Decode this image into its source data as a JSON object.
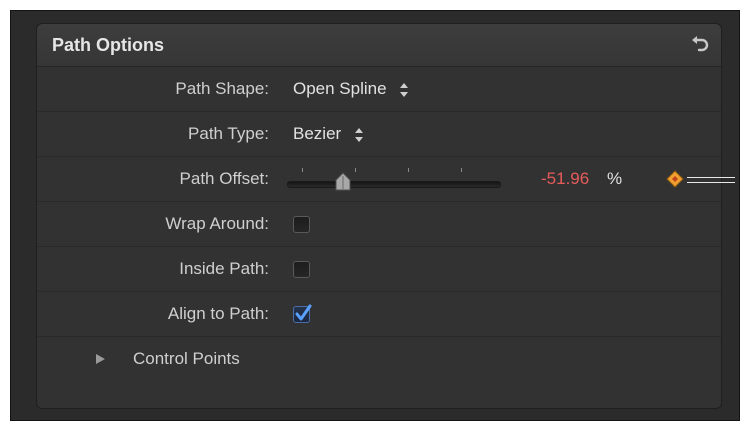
{
  "panel": {
    "title": "Path Options"
  },
  "rows": {
    "path_shape": {
      "label": "Path Shape:",
      "value": "Open Spline"
    },
    "path_type": {
      "label": "Path Type:",
      "value": "Bezier"
    },
    "path_offset": {
      "label": "Path Offset:",
      "value": "-51.96",
      "unit": "%",
      "slider_fraction": 0.24
    },
    "wrap_around": {
      "label": "Wrap Around:",
      "checked": false
    },
    "inside_path": {
      "label": "Inside Path:",
      "checked": false
    },
    "align_to_path": {
      "label": "Align to Path:",
      "checked": true
    },
    "control_points": {
      "label": "Control Points",
      "expanded": false
    }
  },
  "icons": {
    "reset": "reset-arrow-icon",
    "stepper": "up-down-stepper-icon",
    "keyframe": "keyframe-diamond-icon",
    "checkmark": "checkmark-icon",
    "disclosure": "disclosure-triangle-icon"
  },
  "colors": {
    "panel_bg": "#323232",
    "animated_value": "#e85b5b",
    "keyframe": "#f0a030",
    "checkbox_accent": "#4a8cff"
  }
}
